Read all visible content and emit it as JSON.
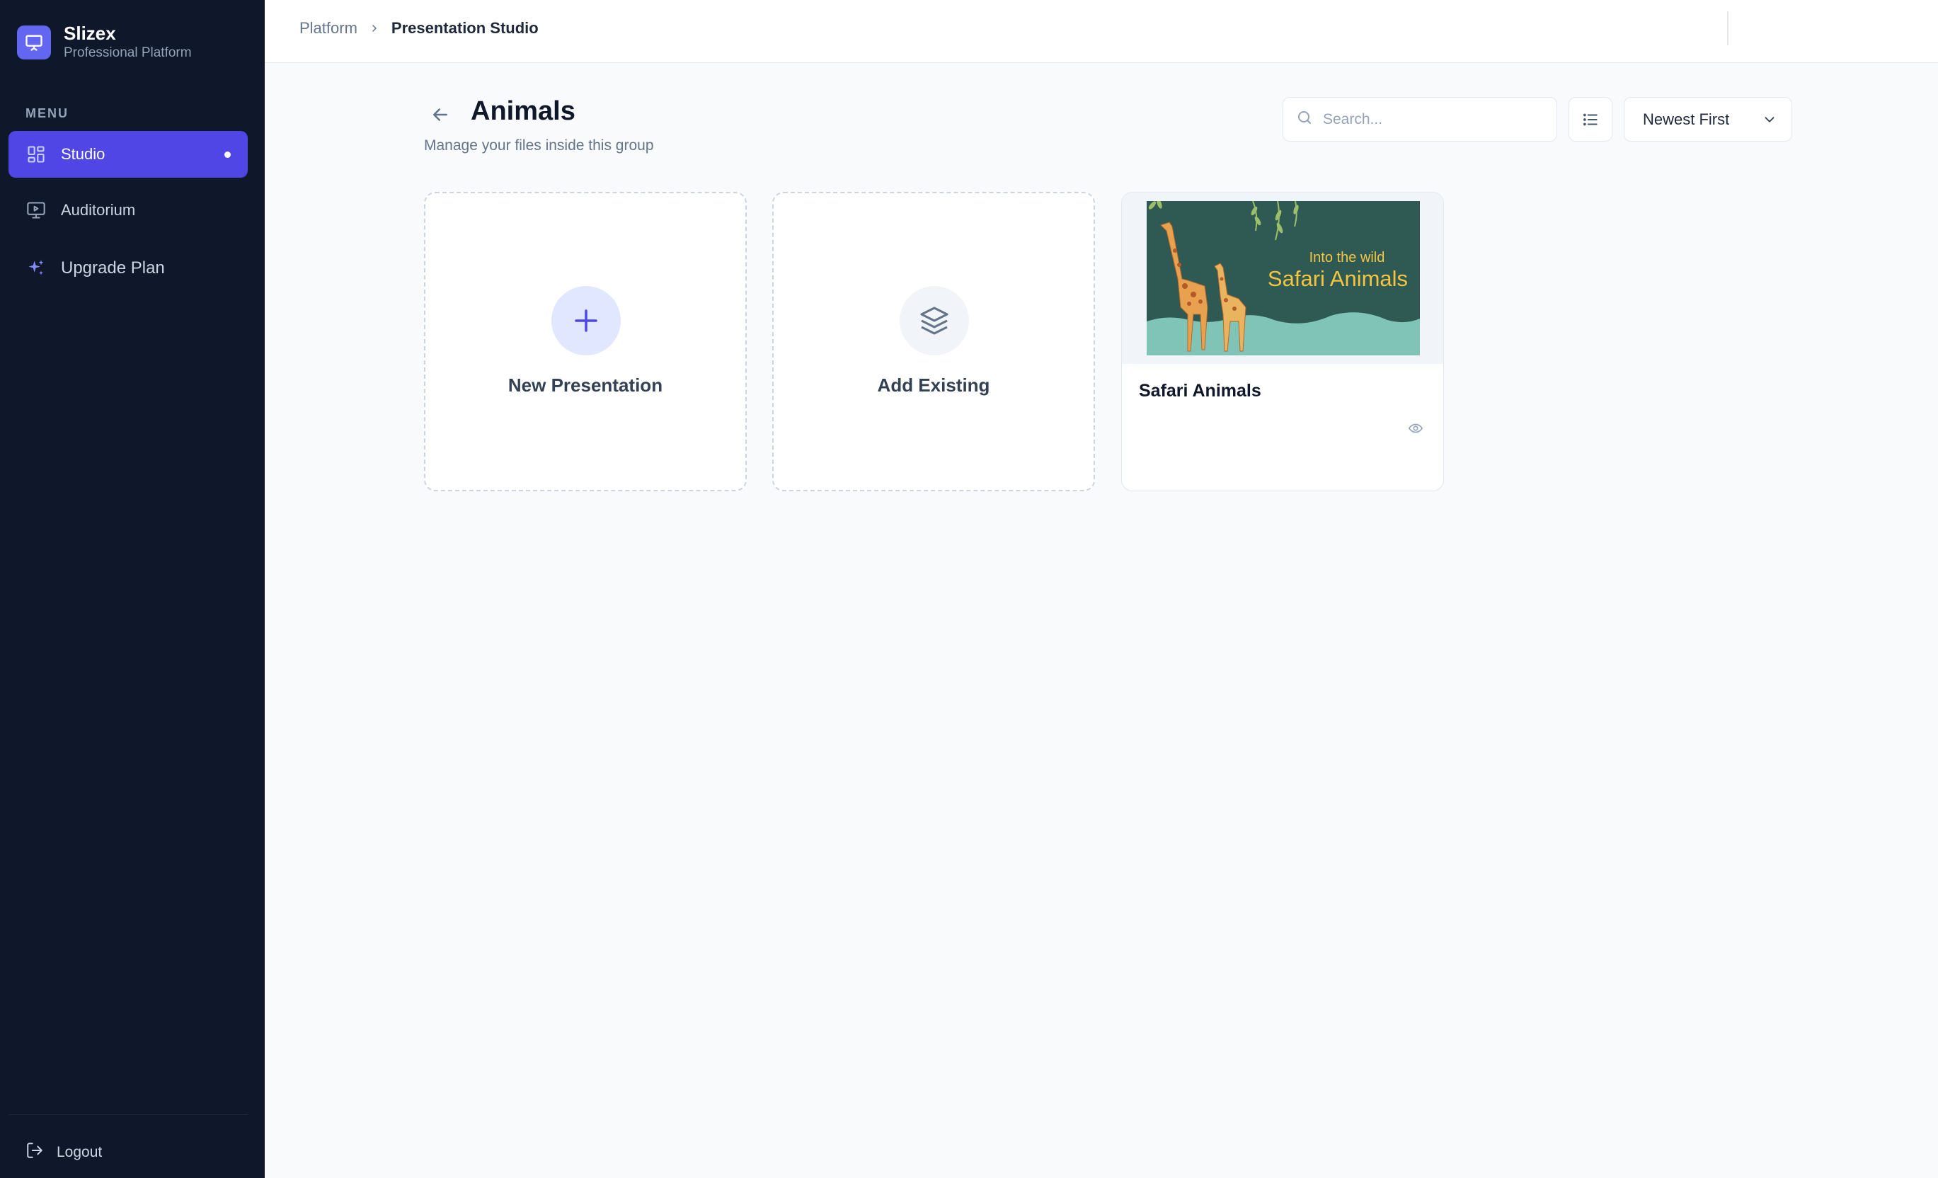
{
  "app": {
    "name": "Slizex",
    "subtitle": "Professional Platform"
  },
  "sidebar": {
    "menu_label": "MENU",
    "items": [
      {
        "label": "Studio",
        "icon": "grid-icon",
        "active": true
      },
      {
        "label": "Auditorium",
        "icon": "presentation-screen-icon",
        "active": false
      },
      {
        "label": "Upgrade Plan",
        "icon": "sparkles-icon",
        "active": false
      }
    ],
    "logout_label": "Logout"
  },
  "breadcrumb": {
    "root": "Platform",
    "current": "Presentation Studio"
  },
  "page": {
    "title": "Animals",
    "subtitle": "Manage your files inside this group"
  },
  "toolbar": {
    "search_placeholder": "Search...",
    "search_value": "",
    "sort_selected": "Newest First"
  },
  "cards": {
    "new_label": "New Presentation",
    "add_existing_label": "Add Existing"
  },
  "presentations": [
    {
      "title": "Safari Animals",
      "thumbnail_kicker": "Into the wild",
      "thumbnail_title": "Safari Animals"
    }
  ],
  "colors": {
    "sidebar_bg": "#0f172a",
    "accent": "#4f46e5",
    "logo_bg": "#6366f1",
    "thumb_bg": "#2f5953",
    "thumb_text": "#f5c542"
  }
}
